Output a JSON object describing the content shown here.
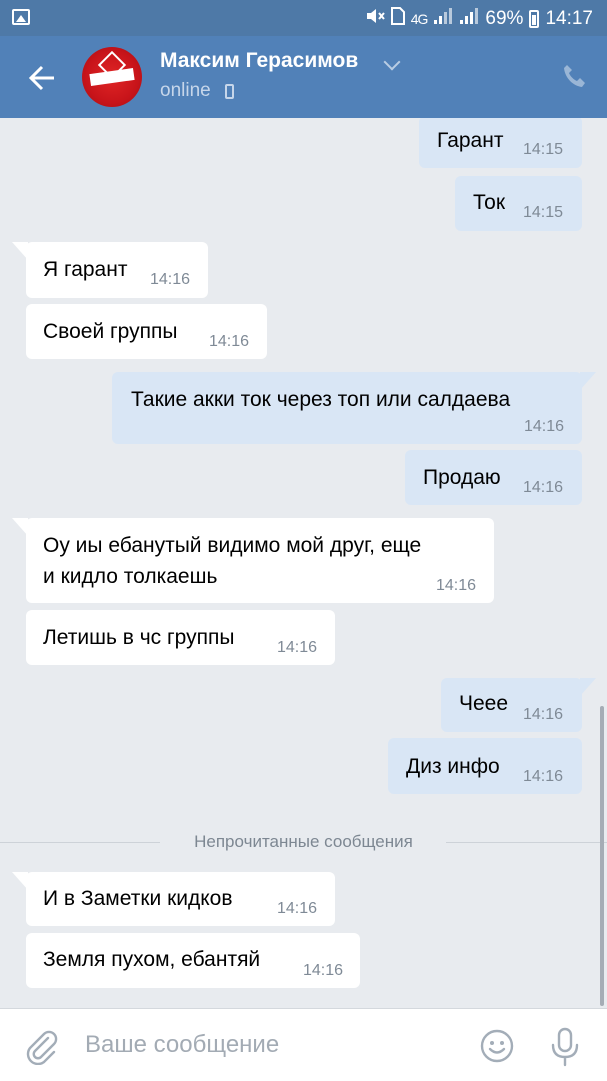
{
  "status_bar": {
    "network": "4G",
    "battery": "69%",
    "time": "14:17"
  },
  "header": {
    "contact_name": "Максим Герасимов",
    "status": "online"
  },
  "messages": [
    {
      "dir": "out",
      "text": "Гарант",
      "time": "14:15"
    },
    {
      "dir": "out",
      "text": "Ток",
      "time": "14:15"
    },
    {
      "dir": "in",
      "text": "Я гарант",
      "time": "14:16"
    },
    {
      "dir": "in",
      "text": "Своей группы",
      "time": "14:16"
    },
    {
      "dir": "out",
      "text": "Такие акки ток через топ или салдаева",
      "time": "14:16"
    },
    {
      "dir": "out",
      "text": "Продаю",
      "time": "14:16"
    },
    {
      "dir": "in",
      "line1": "Оу иы ебанутый видимо мой друг,  еще",
      "line2": "и кидло толкаешь",
      "time": "14:16"
    },
    {
      "dir": "in",
      "text": "Летишь в чс группы",
      "time": "14:16"
    },
    {
      "dir": "out",
      "text": "Чеее",
      "time": "14:16"
    },
    {
      "dir": "out",
      "text": "Диз инфо",
      "time": "14:16"
    },
    {
      "dir": "in",
      "text": "И в Заметки кидков",
      "time": "14:16"
    },
    {
      "dir": "in",
      "text": "Земля пухом,  ебантяй",
      "time": "14:16"
    }
  ],
  "unread_label": "Непрочитанные сообщения",
  "composer": {
    "placeholder": "Ваше сообщение"
  }
}
